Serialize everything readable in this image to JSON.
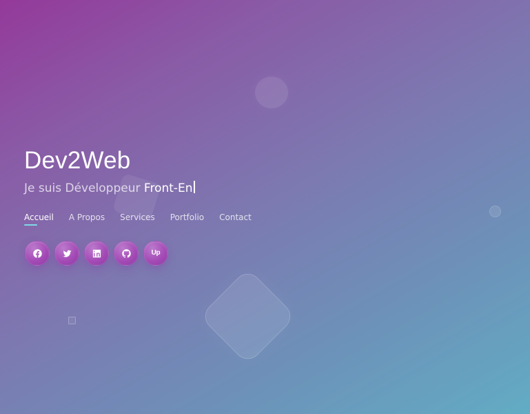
{
  "brand": {
    "name": "Dev2Web"
  },
  "subtitle": {
    "prefix": "Je suis Développeur",
    "typed": "Front-En"
  },
  "navigation": {
    "items": [
      {
        "label": "Accueil",
        "active": true
      },
      {
        "label": "A Propos",
        "active": false
      },
      {
        "label": "Services",
        "active": false
      },
      {
        "label": "Portfolio",
        "active": false
      },
      {
        "label": "Contact",
        "active": false
      }
    ]
  },
  "social": {
    "items": [
      {
        "name": "facebook-icon"
      },
      {
        "name": "twitter-icon"
      },
      {
        "name": "linkedin-icon"
      },
      {
        "name": "github-icon"
      },
      {
        "name": "upwork-icon",
        "text": "Up"
      }
    ]
  },
  "colors": {
    "accent_underline": "#7fd8e8",
    "gradient_start": "#94399a",
    "gradient_end": "#62acc4",
    "social_button": "#a44ab6"
  }
}
